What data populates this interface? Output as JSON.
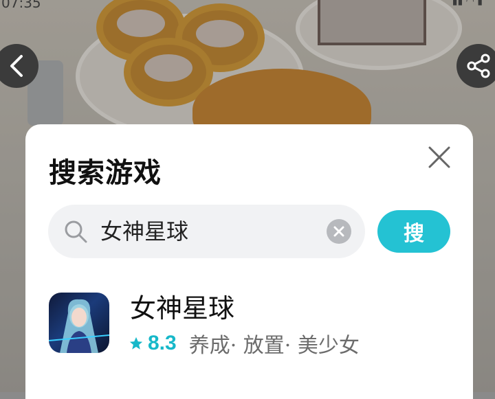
{
  "status_bar": {
    "time": "07:35"
  },
  "dialog": {
    "title": "搜索游戏",
    "search": {
      "value": "女神星球",
      "button_label": "搜"
    },
    "results": [
      {
        "name": "女神星球",
        "rating": "8.3",
        "tags": "养成· 放置· 美少女"
      }
    ]
  },
  "colors": {
    "accent": "#24c2d3",
    "rating": "#17b8c9",
    "overlay_buttons": "#3b3b3b"
  },
  "icons": [
    "back-icon",
    "share-icon",
    "close-icon",
    "search-icon",
    "clear-icon",
    "star-icon"
  ]
}
